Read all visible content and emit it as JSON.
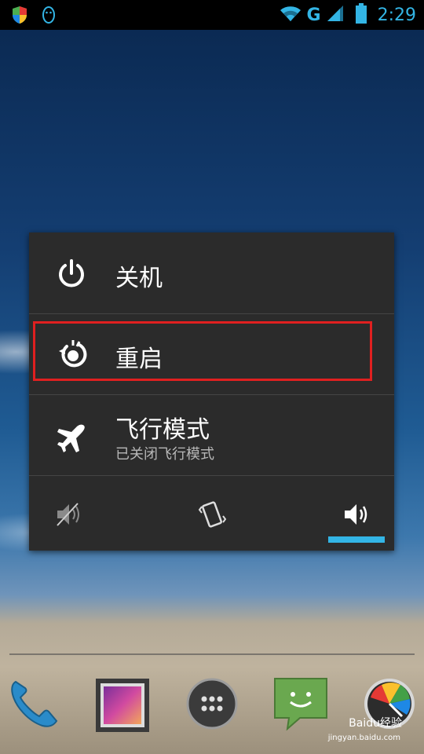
{
  "status_bar": {
    "network_type": "G",
    "time": "2:29",
    "left_icons": [
      "shield-icon",
      "qq-penguin-icon"
    ],
    "right_icons": [
      "wifi-icon",
      "signal-icon",
      "battery-icon"
    ]
  },
  "power_menu": {
    "items": [
      {
        "label": "关机",
        "icon": "power-icon"
      },
      {
        "label": "重启",
        "icon": "reboot-icon"
      },
      {
        "label": "飞行模式",
        "sublabel": "已关闭飞行模式",
        "icon": "airplane-icon"
      }
    ],
    "sound_modes": [
      "silent-icon",
      "vibrate-icon",
      "sound-on-icon"
    ],
    "selected_sound_mode": "sound-on-icon"
  },
  "dock": {
    "apps": [
      "phone-icon",
      "gallery-icon",
      "app-drawer-icon",
      "messaging-icon",
      "cleaner-icon"
    ]
  },
  "watermark": {
    "brand": "Baidu经验",
    "url": "jingyan.baidu.com"
  },
  "colors": {
    "accent": "#33b5e5",
    "highlight_border": "#e02020",
    "dialog_bg": "#2b2b2b"
  }
}
